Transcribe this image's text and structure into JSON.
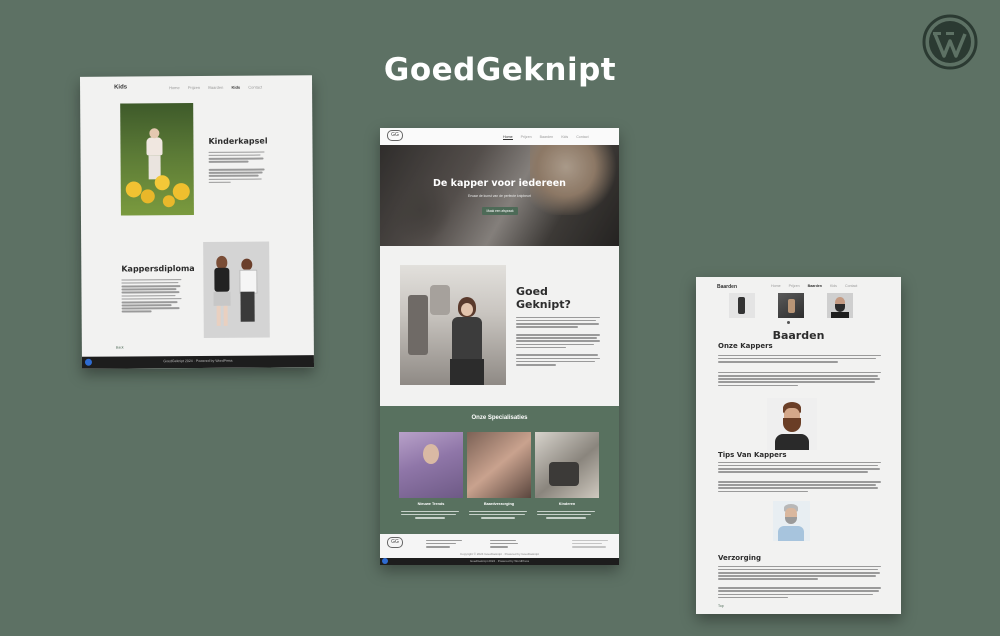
{
  "hero_title": "GoedGeknipt",
  "brand_icon": "wordpress-icon",
  "left_card": {
    "page_label": "Kids",
    "nav": [
      "Home",
      "Prijzen",
      "Baarden",
      "Kids",
      "Contact"
    ],
    "active_nav": "Kids",
    "section1_title": "Kinderkapsel",
    "section2_title": "Kappersdiploma",
    "footer_link": "Back",
    "footer_text": "GoedGeknipt 2024 · Powered by WordPress"
  },
  "center_card": {
    "logo_text": "GG",
    "nav": [
      "Home",
      "Prijzen",
      "Baarden",
      "Kids",
      "Contact"
    ],
    "active_nav": "Home",
    "banner_title": "De kapper voor iedereen",
    "banner_subtitle": "Ervaar de kunst van de perfecte knipbeurt",
    "banner_button": "Maak een afspraak",
    "about_title_line1": "Goed",
    "about_title_line2": "Geknipt?",
    "specialisations_title": "Onze Specialisaties",
    "specialisations": [
      {
        "title": "Nieuwe Trends"
      },
      {
        "title": "Baardverzorging"
      },
      {
        "title": "Kinderen"
      }
    ],
    "footer_logo": "GG",
    "copyright": "Copyright © 2024 GoedGeknipt · Powered by GoedGeknipt",
    "bottom_bar": "GoedGeknipt 2024 · Powered by WordPress"
  },
  "right_card": {
    "page_label": "Baarden",
    "nav": [
      "Home",
      "Prijzen",
      "Baarden",
      "Kids",
      "Contact"
    ],
    "active_nav": "Baarden",
    "main_title": "Baarden",
    "sub_title": "Onze Kappers",
    "section2_title": "Tips Van Kappers",
    "section3_title": "Verzorging",
    "footer_link": "Top"
  },
  "colors": {
    "background": "#5d7164",
    "card": "#f2f2f1",
    "accent_green": "#4d6a57",
    "dark_text": "#2d2d2d"
  }
}
